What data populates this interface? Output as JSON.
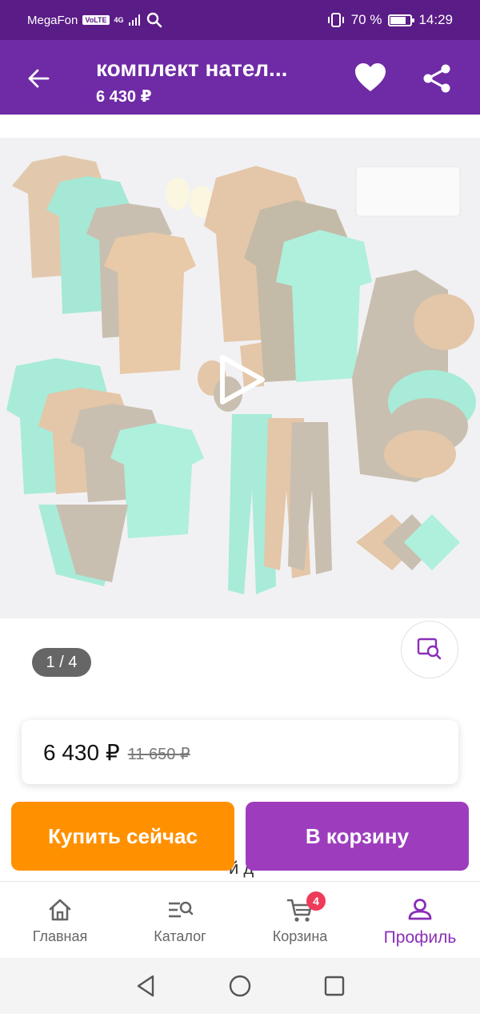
{
  "status": {
    "carrier": "MegaFon",
    "volte": "VoLTE",
    "network": "4G",
    "battery": "70 %",
    "time": "14:29",
    "battery_level": 0.7
  },
  "header": {
    "title": "комплект нател...",
    "price": "6 430 ₽"
  },
  "gallery": {
    "counter": "1 / 4",
    "current": 1,
    "total": 4
  },
  "price_card": {
    "current": "6 430 ₽",
    "old": "11 650 ₽"
  },
  "actions": {
    "buy_now": "Купить сейчас",
    "add_to_cart": "В корзину",
    "peek_text": "й д"
  },
  "bottom_nav": {
    "home": "Главная",
    "catalog": "Каталог",
    "cart": "Корзина",
    "cart_count": "4",
    "profile": "Профиль"
  },
  "colors": {
    "status_bar": "#5a1c86",
    "header": "#6f2aa6",
    "buy_button": "#ff9100",
    "cart_button": "#9d3dbd",
    "active_nav": "#8a2eb8",
    "badge": "#ef3b5a"
  },
  "icons": [
    "back-arrow-icon",
    "heart-icon",
    "share-icon",
    "play-icon",
    "visual-search-icon",
    "home-icon",
    "catalog-search-icon",
    "cart-icon",
    "profile-icon",
    "back-triangle-icon",
    "home-circle-icon",
    "recents-square-icon"
  ]
}
